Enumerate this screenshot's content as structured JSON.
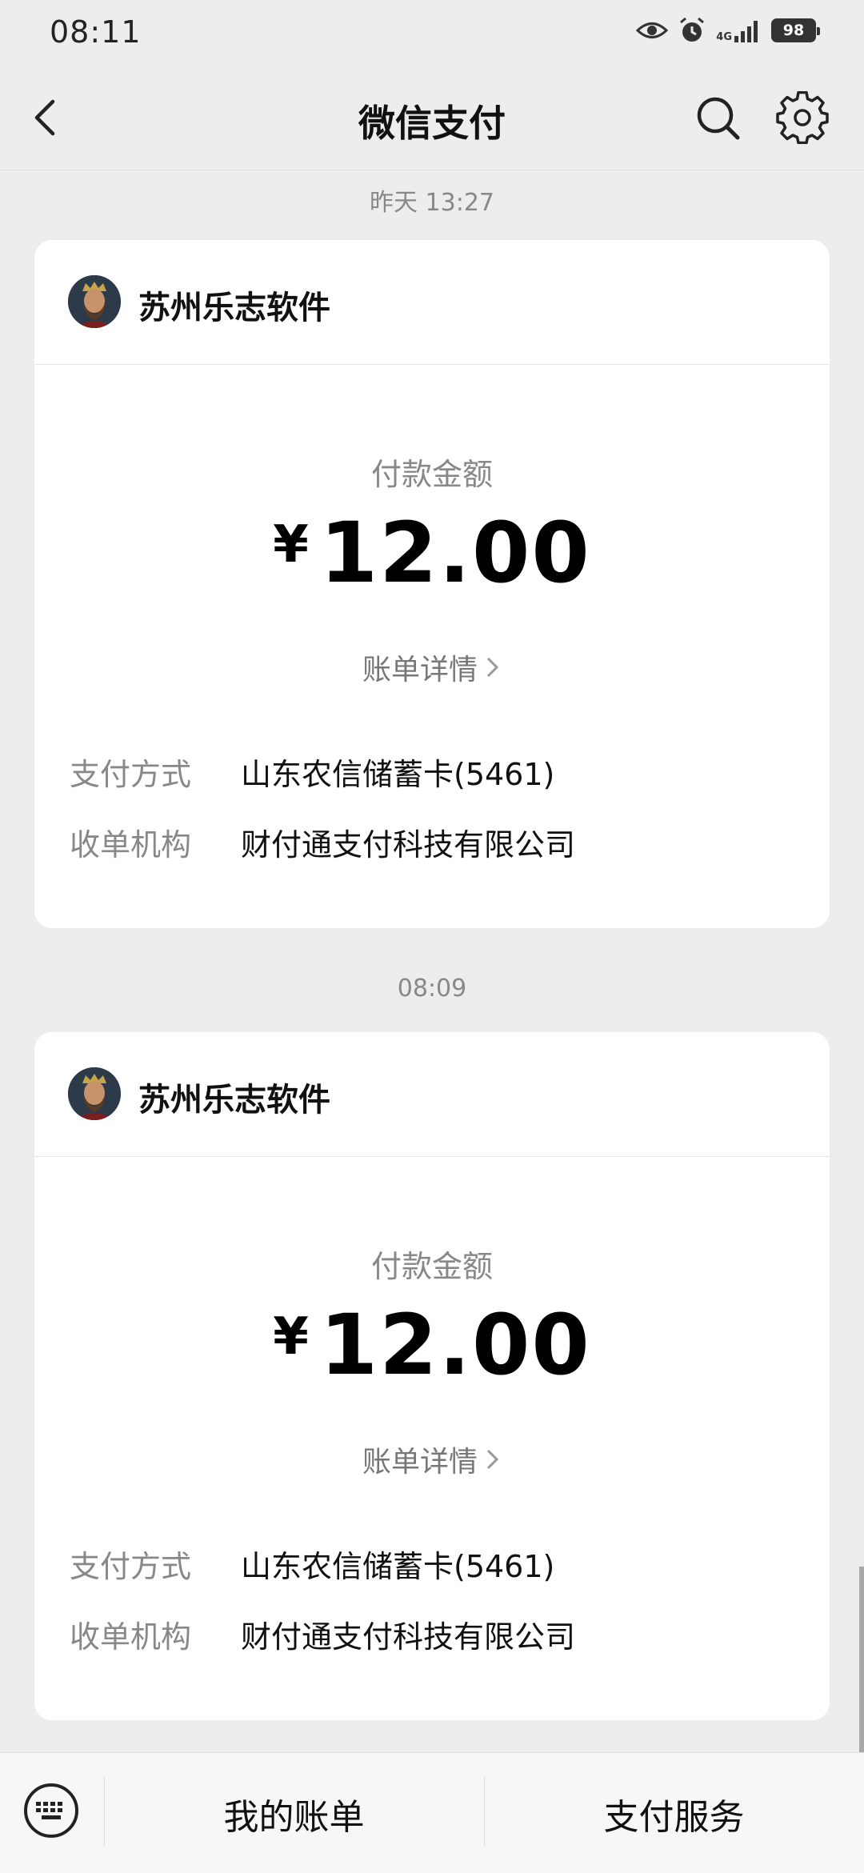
{
  "status_bar": {
    "time": "08:11",
    "battery": "98",
    "network": "4G"
  },
  "nav": {
    "title": "微信支付"
  },
  "messages": [
    {
      "timestamp": "昨天 13:27",
      "merchant": "苏州乐志软件",
      "amount_label": "付款金额",
      "currency": "¥",
      "amount": "12.00",
      "detail_link": "账单详情",
      "payment_method_label": "支付方式",
      "payment_method": "山东农信储蓄卡(5461)",
      "acquirer_label": "收单机构",
      "acquirer": "财付通支付科技有限公司"
    },
    {
      "timestamp": "08:09",
      "merchant": "苏州乐志软件",
      "amount_label": "付款金额",
      "currency": "¥",
      "amount": "12.00",
      "detail_link": "账单详情",
      "payment_method_label": "支付方式",
      "payment_method": "山东农信储蓄卡(5461)",
      "acquirer_label": "收单机构",
      "acquirer": "财付通支付科技有限公司"
    }
  ],
  "bottom_bar": {
    "my_bills": "我的账单",
    "pay_service": "支付服务"
  }
}
